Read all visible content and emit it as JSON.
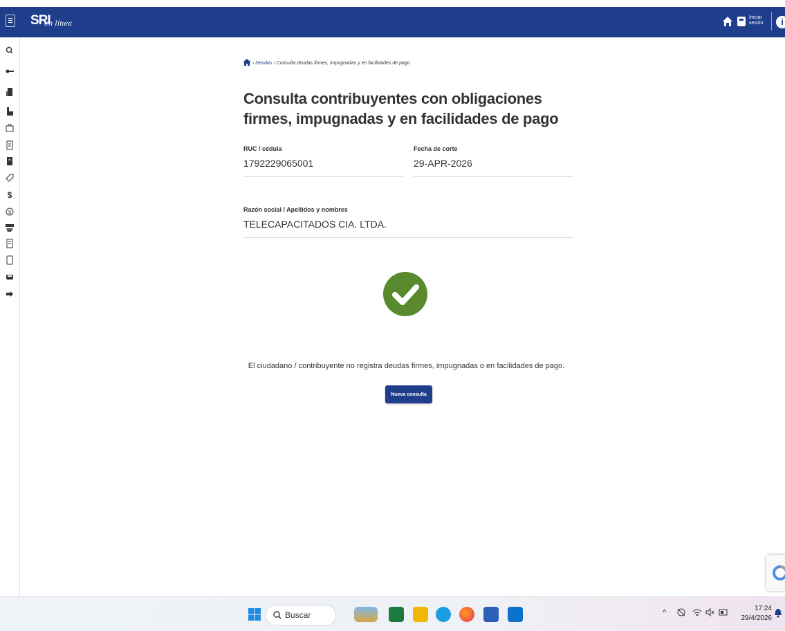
{
  "app": {
    "logo_text": "SRI",
    "logo_sub": "en línea",
    "login_line1": "Iniciar",
    "login_line2": "sesión",
    "info_label": "i"
  },
  "breadcrumb": {
    "link": "Deudas",
    "separator": "›",
    "current": "Consulta deudas firmes, impugnadas y en facilidades de pago"
  },
  "page": {
    "title": "Consulta contribuyentes con obligaciones firmes, impugnadas y en facilidades de pago",
    "ruc_label": "RUC / cédula",
    "ruc_value": "1792229065001",
    "fecha_label": "Fecha de corte",
    "fecha_value": "29-APR-2026",
    "razon_label": "Razón social / Apellidos y nombres",
    "razon_value": "TELECAPACITADOS CIA. LTDA.",
    "result_message": "El ciudadano / contribuyente no registra deudas firmes, impugnadas o en facilidades de pago.",
    "new_query_button": "Nueva consulta"
  },
  "sidebar_icons": [
    "search-icon",
    "key-icon",
    "building-icon",
    "factory-icon",
    "briefcase-icon",
    "document-icon",
    "file-icon",
    "tag-icon",
    "dollar-icon",
    "coin-icon",
    "money-hand-icon",
    "receipt-icon",
    "page-icon",
    "car-icon",
    "arrow-right-icon"
  ],
  "taskbar": {
    "search_placeholder": "Buscar",
    "clock_time": "17:24",
    "clock_date": "29/4/2026",
    "apps": [
      "windows-start-icon",
      "weather-icon",
      "excel-icon",
      "file-explorer-icon",
      "edge-icon",
      "firefox-icon",
      "word-icon",
      "outlook-icon"
    ]
  },
  "colors": {
    "brand": "#1e3d8a",
    "success": "#5a8a2e"
  }
}
